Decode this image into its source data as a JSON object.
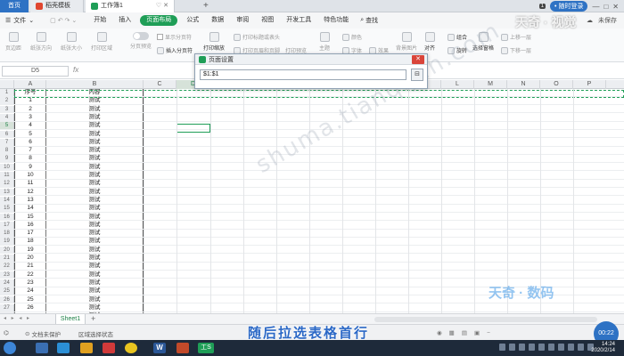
{
  "tabs": {
    "home": "首页",
    "t1": "稻壳模板",
    "t2": "工作簿1",
    "add": "+"
  },
  "titlebar": {
    "badge": "1",
    "login": "• 随时登录",
    "win_min": "—",
    "win_max": "□",
    "win_close": "✕"
  },
  "menu": {
    "file": "文件",
    "items": [
      "开始",
      "插入",
      "页面布局",
      "公式",
      "数据",
      "审阅",
      "视图",
      "开发工具",
      "特色功能"
    ],
    "search": "查找",
    "sync": "未保存"
  },
  "ribbon": {
    "margins": "页边距",
    "orientation": "纸张方向",
    "size": "纸张大小",
    "print_area": "打印区域",
    "page_break": "分页预览",
    "show_break": "显示分页符",
    "insert_break": "插入分页符",
    "print_scale": "打印缩放",
    "print_titles": "打印标题或表头",
    "print_header": "打印页眉和页脚",
    "print_preview": "打印预览",
    "theme": "主题",
    "color": "颜色",
    "font": "字体",
    "effect": "效果",
    "bg_image": "背景图片",
    "align": "对齐",
    "rotate": "旋转",
    "group": "组合",
    "select_pane": "选择窗格",
    "up_layer": "上移一层",
    "down_layer": "下移一层"
  },
  "formula": {
    "namebox": "D5",
    "fx": "fx"
  },
  "columns": [
    "A",
    "B",
    "C",
    "D",
    "E",
    "F",
    "G",
    "H",
    "I",
    "J",
    "K",
    "L",
    "M",
    "N",
    "O",
    "P"
  ],
  "header_row": {
    "a": "序号",
    "b": "内容"
  },
  "rows": [
    {
      "n": "1",
      "a": "1",
      "b": "测试"
    },
    {
      "n": "2",
      "a": "2",
      "b": "测试"
    },
    {
      "n": "3",
      "a": "3",
      "b": "测试"
    },
    {
      "n": "4",
      "a": "4",
      "b": "测试"
    },
    {
      "n": "5",
      "a": "5",
      "b": "测试"
    },
    {
      "n": "6",
      "a": "6",
      "b": "测试"
    },
    {
      "n": "7",
      "a": "7",
      "b": "测试"
    },
    {
      "n": "8",
      "a": "8",
      "b": "测试"
    },
    {
      "n": "9",
      "a": "9",
      "b": "测试"
    },
    {
      "n": "10",
      "a": "10",
      "b": "测试"
    },
    {
      "n": "11",
      "a": "11",
      "b": "测试"
    },
    {
      "n": "12",
      "a": "12",
      "b": "测试"
    },
    {
      "n": "13",
      "a": "13",
      "b": "测试"
    },
    {
      "n": "14",
      "a": "14",
      "b": "测试"
    },
    {
      "n": "15",
      "a": "15",
      "b": "测试"
    },
    {
      "n": "16",
      "a": "16",
      "b": "测试"
    },
    {
      "n": "17",
      "a": "17",
      "b": "测试"
    },
    {
      "n": "18",
      "a": "18",
      "b": "测试"
    },
    {
      "n": "19",
      "a": "19",
      "b": "测试"
    },
    {
      "n": "20",
      "a": "20",
      "b": "测试"
    },
    {
      "n": "21",
      "a": "21",
      "b": "测试"
    },
    {
      "n": "22",
      "a": "22",
      "b": "测试"
    },
    {
      "n": "23",
      "a": "23",
      "b": "测试"
    },
    {
      "n": "24",
      "a": "24",
      "b": "测试"
    },
    {
      "n": "25",
      "a": "25",
      "b": "测试"
    },
    {
      "n": "26",
      "a": "26",
      "b": "测试"
    },
    {
      "n": "27",
      "a": "",
      "b": "测试"
    }
  ],
  "dialog": {
    "title": "页面设置",
    "value": "$1:$1",
    "close": "✕"
  },
  "sheetbar": {
    "sheet": "Sheet1",
    "add": "+"
  },
  "status": {
    "protect": "文档未保护",
    "mode": "区域选择状态"
  },
  "caption": "随后拉选表格首行",
  "zoom": "00:22",
  "clock": {
    "time": "14:24",
    "date": "2020/2/14"
  },
  "watermark": "shuma.tianqijun.com",
  "logo_top": "天奇 · 视觉",
  "logo_bottom": "天奇 · 数码",
  "taskbar": {
    "word": "W",
    "et": "工S"
  },
  "colors": {
    "accent": "#1f9e57",
    "blue": "#2e72c4",
    "caption": "#2b68c6"
  }
}
